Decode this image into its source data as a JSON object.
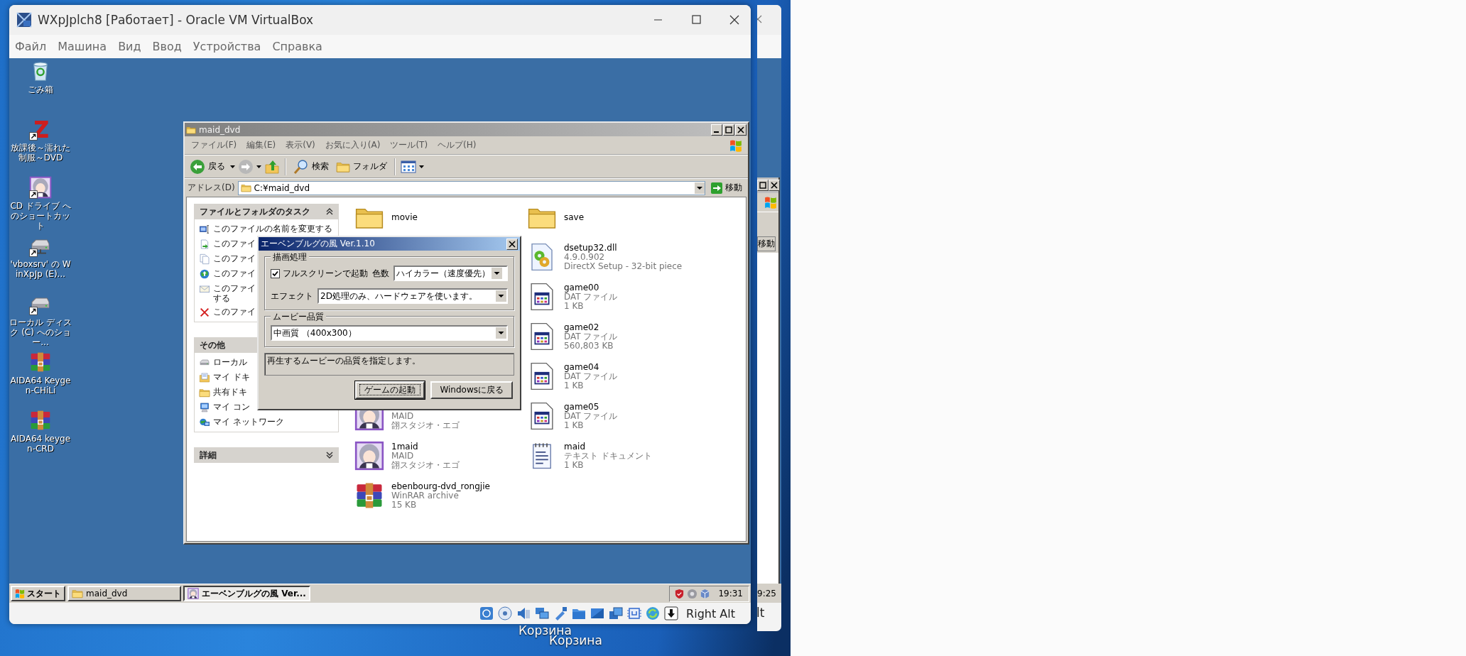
{
  "host": {
    "desktop_labels": [
      "Корзина",
      "Корзина"
    ]
  },
  "vbox": {
    "title": "WXpJplch8 [Работает] - Oracle VM VirtualBox",
    "menu": [
      "Файл",
      "Машина",
      "Вид",
      "Ввод",
      "Устройства",
      "Справка"
    ],
    "status_key": "Right Alt"
  },
  "guest_desktop": {
    "icons": [
      {
        "label": "ごみ箱",
        "kind": "trash",
        "shortcut": false
      },
      {
        "label": "放課後～濡れた制服～DVD",
        "kind": "zigzag",
        "shortcut": true
      },
      {
        "label": "CD ドライブ へのショートカット",
        "kind": "avatar",
        "shortcut": true
      },
      {
        "label": "'vboxsrv' の WinXpJp (E)...",
        "kind": "netdrive",
        "shortcut": true
      },
      {
        "label": "ローカル ディスク (C) へのショー...",
        "kind": "drive",
        "shortcut": true
      },
      {
        "label": "AIDA64 Keygen-CHiLi",
        "kind": "archive",
        "shortcut": false
      },
      {
        "label": "AIDA64 keygen-CRD",
        "kind": "archive",
        "shortcut": false
      }
    ]
  },
  "explorer": {
    "title": "maid_dvd",
    "menu": [
      "ファイル(F)",
      "編集(E)",
      "表示(V)",
      "お気に入り(A)",
      "ツール(T)",
      "ヘルプ(H)"
    ],
    "toolbar": {
      "back": "戻る",
      "search": "検索",
      "folders": "フォルダ"
    },
    "address": {
      "label": "アドレス(D)",
      "value": "C:¥maid_dvd",
      "go": "移動"
    },
    "task_panels": [
      {
        "title": "ファイルとフォルダのタスク",
        "expanded": true,
        "items": [
          {
            "lines": [
              "このファイルの名前を変更する"
            ],
            "kind": "rename"
          },
          {
            "lines": [
              "このファイ"
            ],
            "kind": "move"
          },
          {
            "lines": [
              "このファイ"
            ],
            "kind": "copy"
          },
          {
            "lines": [
              "このファイ"
            ],
            "kind": "web"
          },
          {
            "lines": [
              "このファイ",
              "する"
            ],
            "kind": "mail"
          },
          {
            "lines": [
              "このファイ"
            ],
            "kind": "delete"
          }
        ]
      },
      {
        "title": "その他",
        "items": [
          {
            "lines": [
              "ローカル"
            ],
            "kind": "drive"
          },
          {
            "lines": [
              "マイ ドキ"
            ],
            "kind": "docs"
          },
          {
            "lines": [
              "共有ドキ"
            ],
            "kind": "shared"
          },
          {
            "lines": [
              "マイ コン"
            ],
            "kind": "computer"
          },
          {
            "lines": [
              "マイ ネットワーク"
            ],
            "kind": "network"
          }
        ]
      },
      {
        "title": "詳細",
        "expanded": false
      }
    ],
    "files": {
      "columns": [
        [
          {
            "kind": "folder",
            "name": "movie"
          },
          {
            "kind": "avatar",
            "details": [
              "MAID",
              "翖スタジオ・エゴ"
            ]
          },
          {
            "kind": "avatar",
            "name": "1maid",
            "details": [
              "MAID",
              "翖スタジオ・エゴ"
            ]
          },
          {
            "kind": "archive",
            "name": "ebenbourg-dvd_rongjie",
            "details": [
              "WinRAR archive",
              "15 KB"
            ]
          }
        ],
        [
          {
            "kind": "folder",
            "name": "save"
          },
          {
            "kind": "dll",
            "name": "dsetup32.dll",
            "details": [
              "4.9.0.902",
              "DirectX Setup - 32-bit piece"
            ]
          },
          {
            "kind": "dat",
            "name": "game00",
            "details": [
              "DAT ファイル",
              "1 KB"
            ]
          },
          {
            "kind": "dat",
            "name": "game02",
            "details": [
              "DAT ファイル",
              "560,803 KB"
            ]
          },
          {
            "kind": "dat",
            "name": "game04",
            "details": [
              "DAT ファイル",
              "1 KB"
            ]
          },
          {
            "kind": "dat",
            "name": "game05",
            "details": [
              "DAT ファイル",
              "1 KB"
            ]
          },
          {
            "kind": "text",
            "name": "maid",
            "details": [
              "テキスト ドキュメント",
              "1 KB"
            ]
          }
        ]
      ]
    }
  },
  "dialog": {
    "title": "エーベンブルグの風 Ver.1.10",
    "render_group": {
      "title": "描画処理",
      "fullscreen": {
        "label": "フルスクリーンで起動",
        "checked": true
      },
      "colors": {
        "label": "色数",
        "value": "ハイカラー（速度優先）"
      },
      "effect": {
        "label": "エフェクト",
        "value": "2D処理のみ、ハードウェアを使います。"
      }
    },
    "movie_group": {
      "title": "ムービー品質",
      "value": "中画質 （400x300）"
    },
    "hint": "再生するムービーの品質を指定します。",
    "buttons": [
      {
        "label": "ゲームの起動",
        "focused": true
      },
      {
        "label": "Windowsに戻る",
        "focused": false
      }
    ]
  },
  "taskbar": {
    "start": "スタート",
    "tasks": [
      {
        "label": "maid_dvd",
        "kind": "folder",
        "selected": false
      },
      {
        "label": "エーベンブルグの風 Ver...",
        "kind": "avatar",
        "selected": true
      }
    ],
    "clock": "19:31"
  },
  "back_window": {
    "go": "移動",
    "clock": "9:25",
    "status_key": "lt"
  }
}
